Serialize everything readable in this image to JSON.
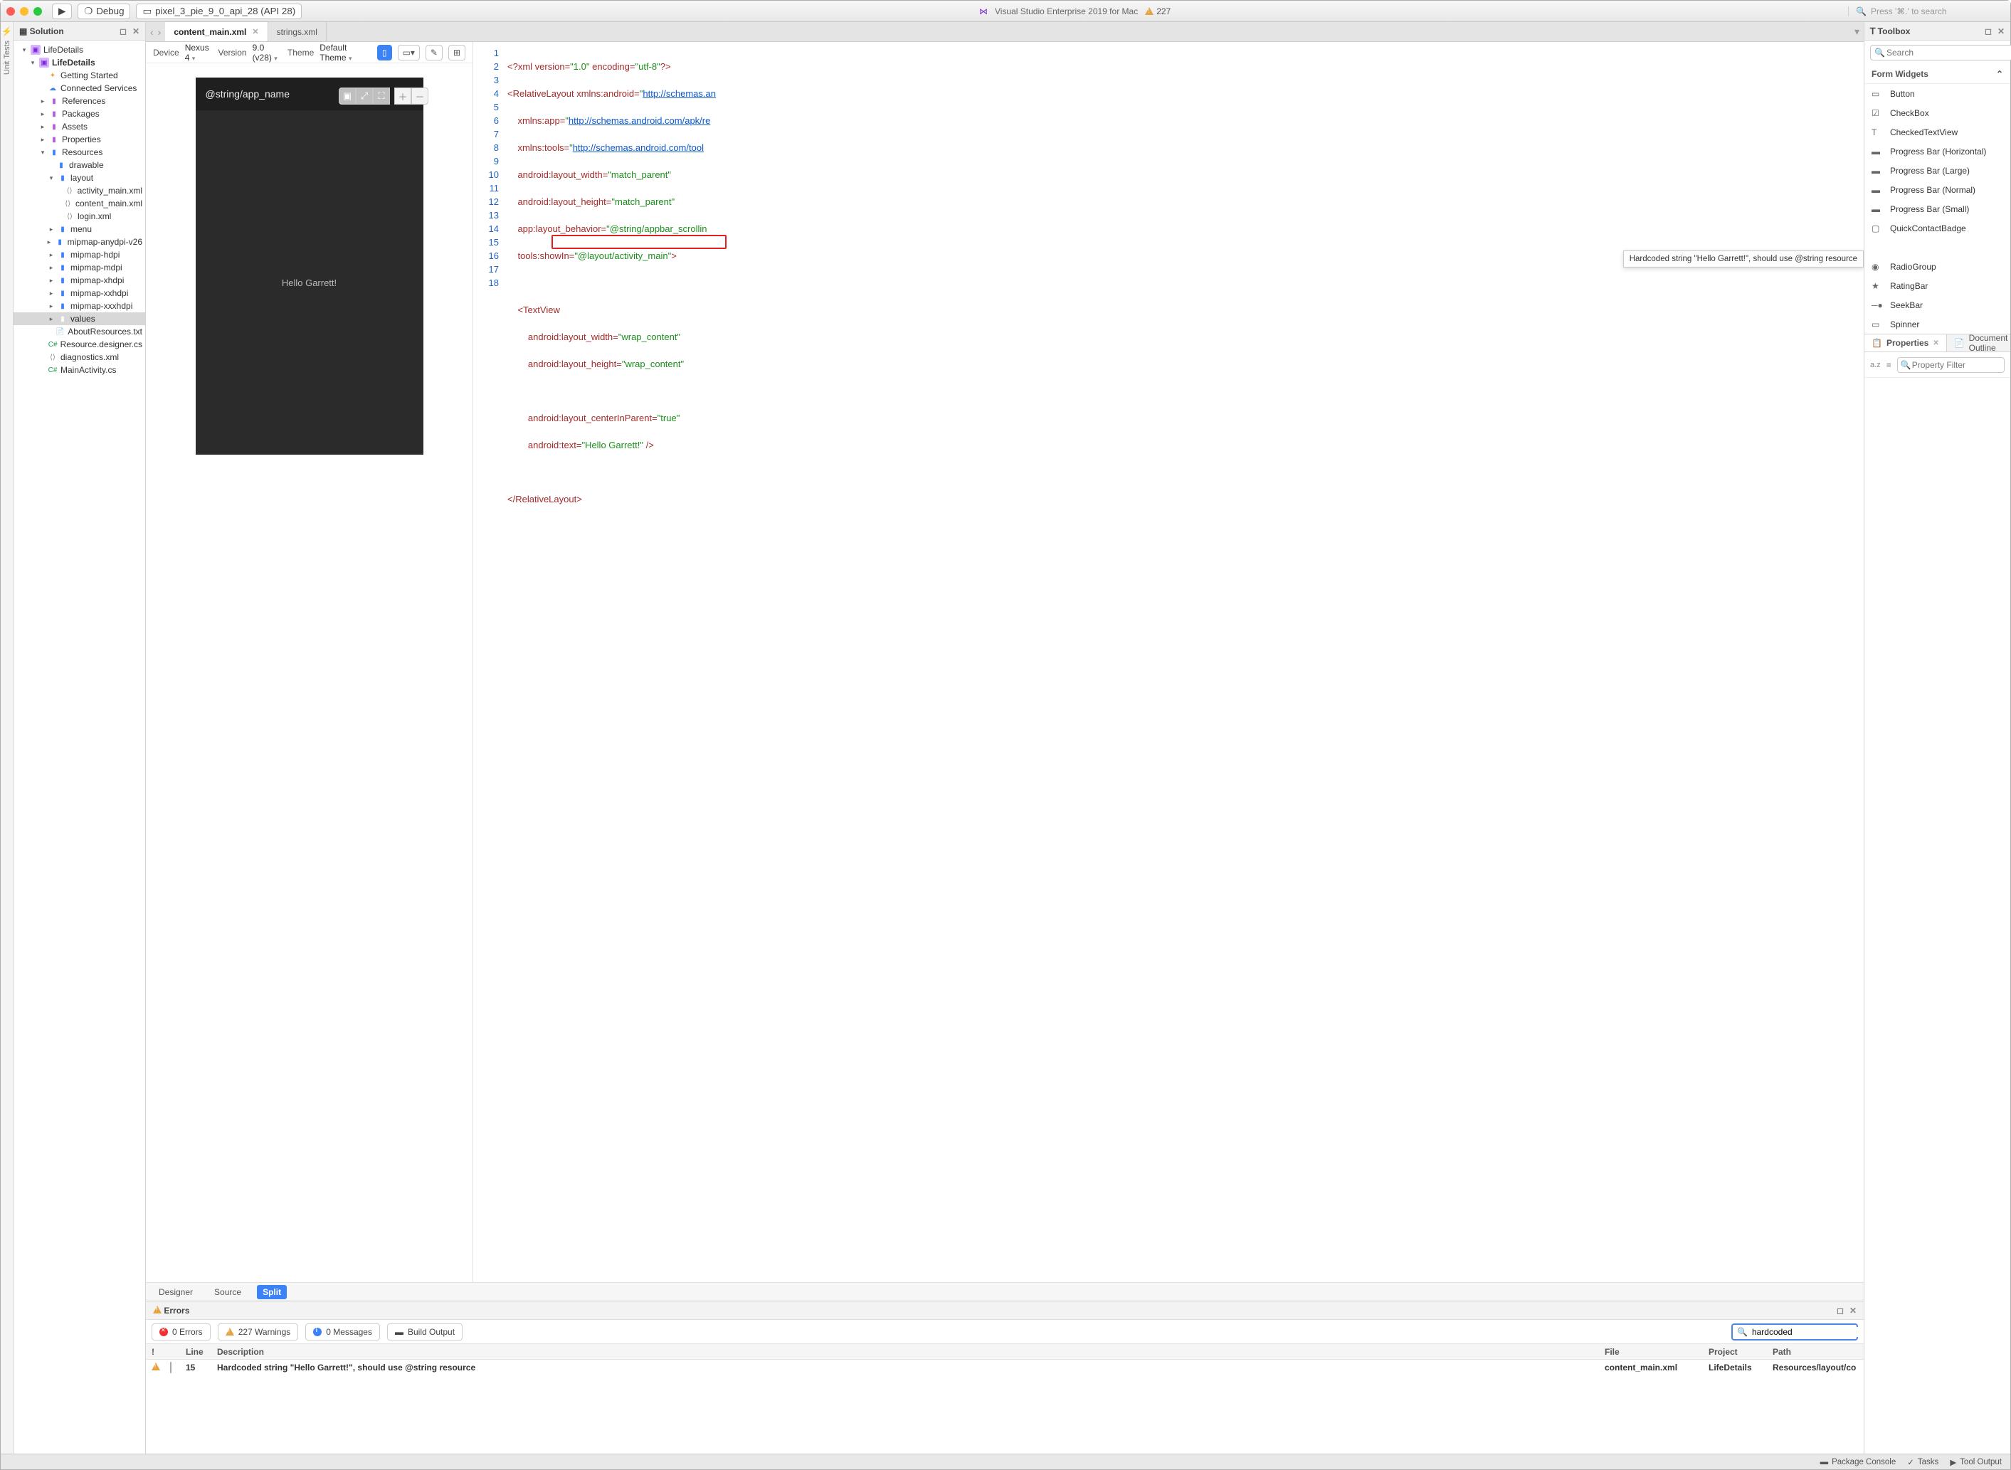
{
  "titlebar": {
    "config": "Debug",
    "device": "pixel_3_pie_9_0_api_28 (API 28)",
    "app_title": "Visual Studio Enterprise 2019 for Mac",
    "warn_count": "227",
    "search_placeholder": "Press '⌘.' to search"
  },
  "solution": {
    "header": "Solution",
    "root": "LifeDetails",
    "project": "LifeDetails",
    "items": [
      {
        "label": "Getting Started",
        "icon": "spark"
      },
      {
        "label": "Connected Services",
        "icon": "cloud"
      }
    ],
    "folders_purple": [
      "References",
      "Packages",
      "Assets",
      "Properties"
    ],
    "resources": {
      "label": "Resources",
      "drawable": "drawable",
      "layout": {
        "label": "layout",
        "files": [
          "activity_main.xml",
          "content_main.xml",
          "login.xml"
        ]
      },
      "menu": "menu",
      "mips": [
        "mipmap-anydpi-v26",
        "mipmap-hdpi",
        "mipmap-mdpi",
        "mipmap-xhdpi",
        "mipmap-xxhdpi",
        "mipmap-xxxhdpi"
      ],
      "values": "values"
    },
    "loose_files": [
      "AboutResources.txt",
      "Resource.designer.cs"
    ],
    "root_files": [
      "diagnostics.xml",
      "MainActivity.cs"
    ]
  },
  "tabs": {
    "active": "content_main.xml",
    "other": "strings.xml"
  },
  "designer_toolbar": {
    "device_lbl": "Device",
    "device_val": "Nexus 4",
    "version_lbl": "Version",
    "version_val": "9.0 (v28)",
    "theme_lbl": "Theme",
    "theme_val": "Default Theme"
  },
  "preview": {
    "title": "@string/app_name",
    "body": "Hello Garrett!"
  },
  "view_tabs": {
    "designer": "Designer",
    "source": "Source",
    "split": "Split"
  },
  "code": {
    "lines": [
      1,
      2,
      3,
      4,
      5,
      6,
      7,
      8,
      9,
      10,
      11,
      12,
      13,
      14,
      15,
      16,
      17,
      18
    ],
    "l1a": "<?xml",
    "l1b": "version=",
    "l1c": "\"1.0\"",
    "l1d": "encoding=",
    "l1e": "\"utf-8\"",
    "l1f": "?>",
    "l2a": "<RelativeLayout",
    "l2b": "xmlns:android=",
    "l2c": "\"",
    "l2d": "http://schemas.an",
    "l3a": "xmlns:app=",
    "l3b": "http://schemas.android.com/apk/re",
    "l4a": "xmlns:tools=",
    "l4b": "http://schemas.android.com/tool",
    "l5a": "android:layout_width=",
    "l5b": "\"match_parent\"",
    "l6a": "android:layout_height=",
    "l6b": "\"match_parent\"",
    "l7a": "app:layout_behavior=",
    "l7b": "\"@string/appbar_scrollin",
    "l8a": "tools:showIn=",
    "l8b": "\"@layout/activity_main\"",
    "l8c": ">",
    "l10": "<TextView",
    "l11a": "android:layout_width=",
    "l11b": "\"wrap_content\"",
    "l12a": "android:layout_height=",
    "l12b": "\"wrap_content\"",
    "l14a": "android:layout_centerInParent=",
    "l14b": "\"true\"",
    "l15a": "android:text=",
    "l15b": "\"Hello Garrett!\"",
    "l15c": " />",
    "l17": "</RelativeLayout>"
  },
  "tooltip": "Hardcoded string \"Hello Garrett!\", should use @string resource",
  "errors": {
    "header": "Errors",
    "chips": {
      "errors": "0 Errors",
      "warnings": "227 Warnings",
      "messages": "0 Messages",
      "build": "Build Output"
    },
    "search_value": "hardcoded",
    "cols": {
      "mark": "!",
      "line": "Line",
      "desc": "Description",
      "file": "File",
      "proj": "Project",
      "path": "Path"
    },
    "row": {
      "line": "15",
      "desc": "Hardcoded string \"Hello Garrett!\", should use @string resource",
      "file": "content_main.xml",
      "proj": "LifeDetails",
      "path": "Resources/layout/co"
    }
  },
  "toolbox": {
    "header": "Toolbox",
    "search_ph": "Search",
    "group": "Form Widgets",
    "items": [
      "Button",
      "CheckBox",
      "CheckedTextView",
      "Progress Bar (Horizontal)",
      "Progress Bar (Large)",
      "Progress Bar (Normal)",
      "Progress Bar (Small)",
      "QuickContactBadge",
      "",
      "RadioGroup",
      "RatingBar",
      "SeekBar",
      "Spinner"
    ]
  },
  "props": {
    "tab1": "Properties",
    "tab2": "Document Outline",
    "az": "a.z",
    "filter_ph": "Property Filter"
  },
  "status": {
    "pkg": "Package Console",
    "tasks": "Tasks",
    "tool": "Tool Output"
  },
  "sidebar_vt": "Unit Tests"
}
